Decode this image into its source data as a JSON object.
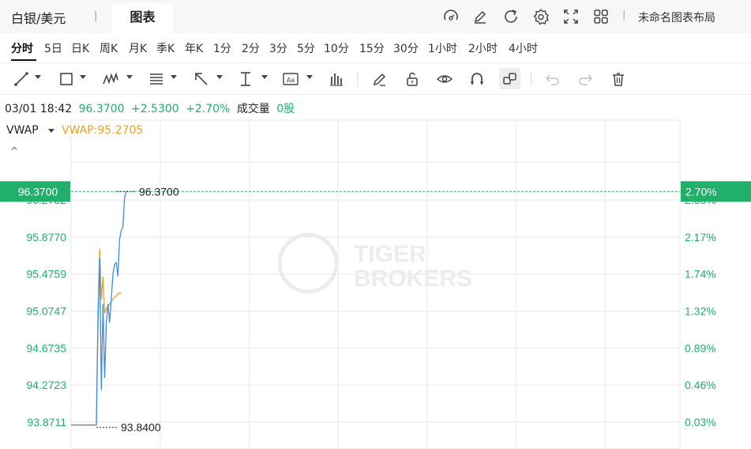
{
  "header": {
    "title": "白银/美元",
    "tab": "图表",
    "layout_name": "未命名图表布局",
    "icons": [
      "gauge-icon",
      "edit-icon",
      "refresh-icon",
      "settings-icon",
      "fullscreen-icon",
      "grid-icon"
    ]
  },
  "periods": [
    {
      "label": "分时",
      "active": true
    },
    {
      "label": "5日"
    },
    {
      "label": "日K"
    },
    {
      "label": "周K"
    },
    {
      "label": "月K"
    },
    {
      "label": "季K"
    },
    {
      "label": "年K"
    },
    {
      "label": "1分"
    },
    {
      "label": "2分"
    },
    {
      "label": "3分"
    },
    {
      "label": "5分"
    },
    {
      "label": "10分"
    },
    {
      "label": "15分"
    },
    {
      "label": "30分"
    },
    {
      "label": "1小时"
    },
    {
      "label": "2小时"
    },
    {
      "label": "4小时"
    }
  ],
  "tools": [
    "trend-line-icon",
    "rectangle-icon",
    "wave-pattern-icon",
    "fibonacci-icon",
    "arrow-icon",
    "measure-icon",
    "text-icon",
    "bar-pattern-icon",
    "pencil-icon",
    "lock-icon",
    "eye-icon",
    "magnet-icon",
    "layer-icon",
    "undo-icon",
    "redo-icon",
    "delete-icon"
  ],
  "quote": {
    "datetime": "03/01 18:42",
    "price": "96.3700",
    "change": "+2.5300",
    "change_pct": "+2.70%",
    "volume_label": "成交量",
    "volume": "0股"
  },
  "indicator": {
    "name": "VWAP",
    "value_text": "VWAP:95.2705",
    "collapse": "^"
  },
  "colors": {
    "up": "#21b06a",
    "price_line": "#3a8ee8",
    "vwap_line": "#f0a020",
    "grid": "#eaeaea",
    "watermark": "#ececec"
  },
  "watermark": {
    "line1": "TIGER",
    "line2": "BROKERS"
  },
  "chart_data": {
    "type": "line",
    "ylim": [
      93.8711,
      96.6817
    ],
    "left_ticks": [
      "96.2782",
      "95.8770",
      "95.4759",
      "95.0747",
      "94.6735",
      "94.2723",
      "93.8711"
    ],
    "right_ticks": [
      "2.60%",
      "2.17%",
      "1.74%",
      "1.32%",
      "0.89%",
      "0.46%",
      "0.03%"
    ],
    "current_price": 96.37,
    "current_price_label": "96.3700",
    "current_pct_label": "2.70%",
    "high_marker": {
      "value": 96.37,
      "label": "96.3700"
    },
    "low_marker": {
      "value": 93.84,
      "label": "93.8400"
    },
    "series": [
      {
        "values": [
          93.84,
          93.84,
          93.84,
          93.84,
          93.84,
          93.84,
          93.84,
          93.84,
          93.84,
          93.84,
          93.84,
          94.95,
          95.65,
          94.22,
          95.15,
          94.35,
          94.95,
          95.15,
          94.95,
          95.2,
          95.48,
          95.58,
          95.6,
          95.45,
          95.85,
          95.95,
          95.98,
          96.3,
          96.37,
          96.37
        ]
      },
      {
        "values": [
          93.84,
          93.84,
          93.84,
          93.84,
          93.84,
          93.84,
          93.84,
          93.84,
          93.84,
          93.84,
          93.84,
          95.1,
          95.75,
          95.2,
          95.45,
          95.05,
          95.1,
          95.12,
          95.15,
          95.18,
          95.2,
          95.22,
          95.24,
          95.26,
          95.27,
          95.27
        ]
      }
    ]
  }
}
